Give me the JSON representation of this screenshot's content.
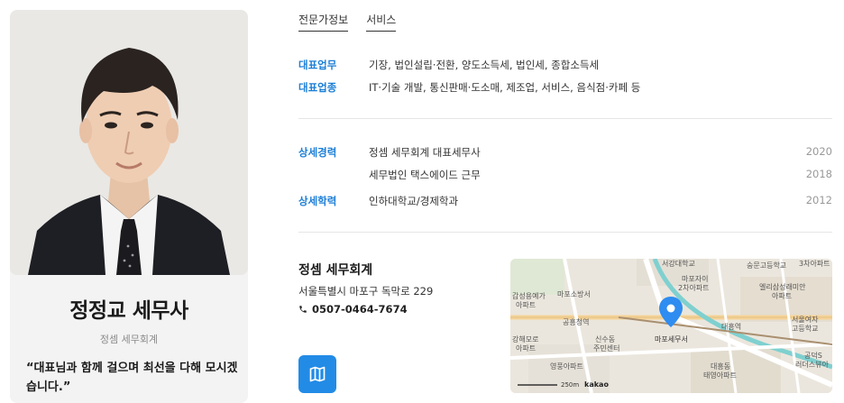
{
  "profile": {
    "name": "정정교 세무사",
    "firm": "정셈 세무회계",
    "quote": "“대표님과 함께 걸으며 최선을 다해 모시겠습니다.”"
  },
  "tabs": [
    "전문가정보",
    "서비스"
  ],
  "info": {
    "main_business_label": "대표업무",
    "main_business_value": "기장, 법인설립·전환, 양도소득세, 법인세, 종합소득세",
    "main_industry_label": "대표업종",
    "main_industry_value": "IT·기술 개발, 통신판매·도소매, 제조업, 서비스, 음식점·카페 등"
  },
  "career": {
    "label": "상세경력",
    "items": [
      {
        "text": "정셈 세무회계 대표세무사",
        "year": "2020"
      },
      {
        "text": "세무법인 택스에이드 근무",
        "year": "2018"
      }
    ]
  },
  "education": {
    "label": "상세학력",
    "items": [
      {
        "text": "인하대학교/경제학과",
        "year": "2012"
      }
    ]
  },
  "office": {
    "name": "정셈 세무회계",
    "address": "서울특별시 마포구 독막로 229",
    "phone": "0507-0464-7674"
  },
  "map": {
    "labels": {
      "l1": "서강대학교",
      "l2": "숭문고등학교",
      "l3": "3차아파트",
      "l4": "마포자이",
      "l5": "2차아파트",
      "l6": "갑성용예가",
      "l7": "아파트",
      "l8": "마포소방서",
      "l9": "엘리삼성래미안",
      "l10": "아파트",
      "l11": "공흥청역",
      "l12": "서울여자",
      "l13": "고등학교",
      "l14": "신수동",
      "l15": "주민센터",
      "l16": "마포세무서",
      "l17": "강해모로",
      "l18": "아파트",
      "l19": "영풍아파트",
      "l20": "대흥동",
      "l21": "태영아파트",
      "l22": "공덕S",
      "l23": "러더스뷰아",
      "l24": "대흥역",
      "scale": "250m",
      "brand": "kakao"
    },
    "marker_color": "#2f8cf0"
  },
  "colors": {
    "accent": "#1c7ed6",
    "button": "#228be6"
  }
}
